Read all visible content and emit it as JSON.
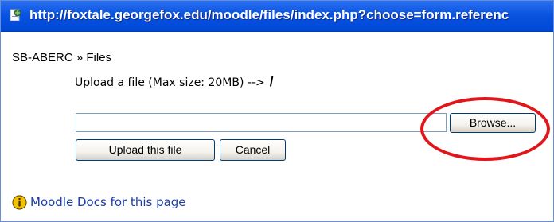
{
  "window": {
    "url": "http://foxtale.georgefox.edu/moodle/files/index.php?choose=form.referenc"
  },
  "breadcrumb": {
    "course": "SB-ABERC",
    "separator": "»",
    "current": "Files"
  },
  "upload": {
    "info_text": "Upload a file (Max size: 20MB) -->",
    "path": "/",
    "file_value": "",
    "browse_label": "Browse...",
    "upload_label": "Upload this file",
    "cancel_label": "Cancel"
  },
  "footer": {
    "docs_link": "Moodle Docs for this page",
    "info_icon": "info-icon"
  },
  "colors": {
    "titlebar": "#0a54e0",
    "link": "#1a3da8",
    "highlight": "#e0161b"
  }
}
